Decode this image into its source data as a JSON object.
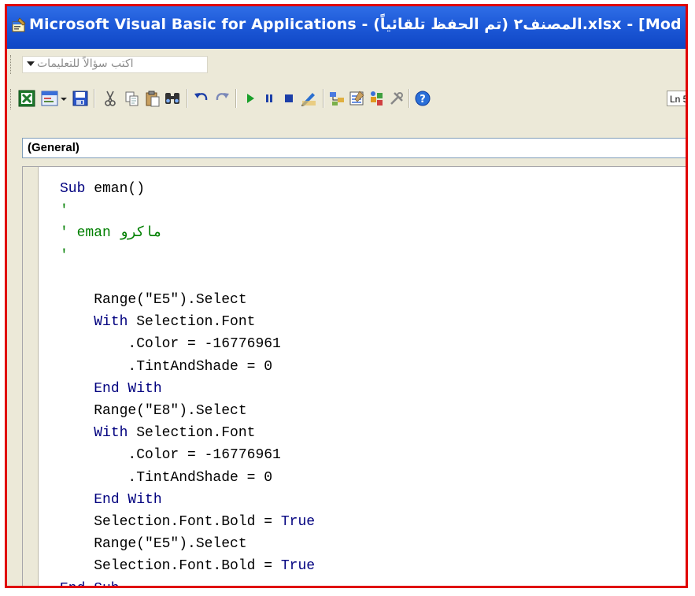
{
  "window": {
    "title": "Microsoft Visual Basic for Applications - المصنف٢ (تم الحفظ تلقائياً).xlsx - [Mod",
    "app_icon": "vba-editor-icon",
    "title_bar_color": "#1d59d8"
  },
  "help_box": {
    "text": "اكتب سؤالاً للتعليمات"
  },
  "toolbar": {
    "buttons": [
      "excel-view-icon",
      "insert-userform-icon",
      "insert-dropdown-icon",
      "save-icon",
      "cut-icon",
      "copy-icon",
      "paste-icon",
      "find-icon",
      "undo-icon",
      "redo-icon",
      "run-icon",
      "break-icon",
      "reset-icon",
      "design-mode-icon",
      "project-explorer-icon",
      "properties-window-icon",
      "object-browser-icon",
      "toolbox-icon",
      "help-icon"
    ],
    "position_label": "Ln 5"
  },
  "object_combo": {
    "value": "(General)"
  },
  "code": {
    "keyword_color": "#00007f",
    "comment_color": "#007f00",
    "lines": [
      [
        {
          "t": "Sub",
          "k": "kw"
        },
        {
          "t": " eman()",
          "k": ""
        }
      ],
      [
        {
          "t": "'",
          "k": "cm"
        }
      ],
      [
        {
          "t": "' eman ماكرو",
          "k": "cm"
        }
      ],
      [
        {
          "t": "'",
          "k": "cm"
        }
      ],
      [],
      [
        {
          "t": "    Range(\"E5\").Select",
          "k": ""
        }
      ],
      [
        {
          "t": "    ",
          "k": ""
        },
        {
          "t": "With",
          "k": "kw"
        },
        {
          "t": " Selection.Font",
          "k": ""
        }
      ],
      [
        {
          "t": "        .Color = -16776961",
          "k": ""
        }
      ],
      [
        {
          "t": "        .TintAndShade = 0",
          "k": ""
        }
      ],
      [
        {
          "t": "    ",
          "k": ""
        },
        {
          "t": "End With",
          "k": "kw"
        }
      ],
      [
        {
          "t": "    Range(\"E8\").Select",
          "k": ""
        }
      ],
      [
        {
          "t": "    ",
          "k": ""
        },
        {
          "t": "With",
          "k": "kw"
        },
        {
          "t": " Selection.Font",
          "k": ""
        }
      ],
      [
        {
          "t": "        .Color = -16776961",
          "k": ""
        }
      ],
      [
        {
          "t": "        .TintAndShade = 0",
          "k": ""
        }
      ],
      [
        {
          "t": "    ",
          "k": ""
        },
        {
          "t": "End With",
          "k": "kw"
        }
      ],
      [
        {
          "t": "    Selection.Font.Bold = ",
          "k": ""
        },
        {
          "t": "True",
          "k": "kw"
        }
      ],
      [
        {
          "t": "    Range(\"E5\").Select",
          "k": ""
        }
      ],
      [
        {
          "t": "    Selection.Font.Bold = ",
          "k": ""
        },
        {
          "t": "True",
          "k": "kw"
        }
      ],
      [
        {
          "t": "End Sub",
          "k": "kw"
        }
      ]
    ]
  }
}
